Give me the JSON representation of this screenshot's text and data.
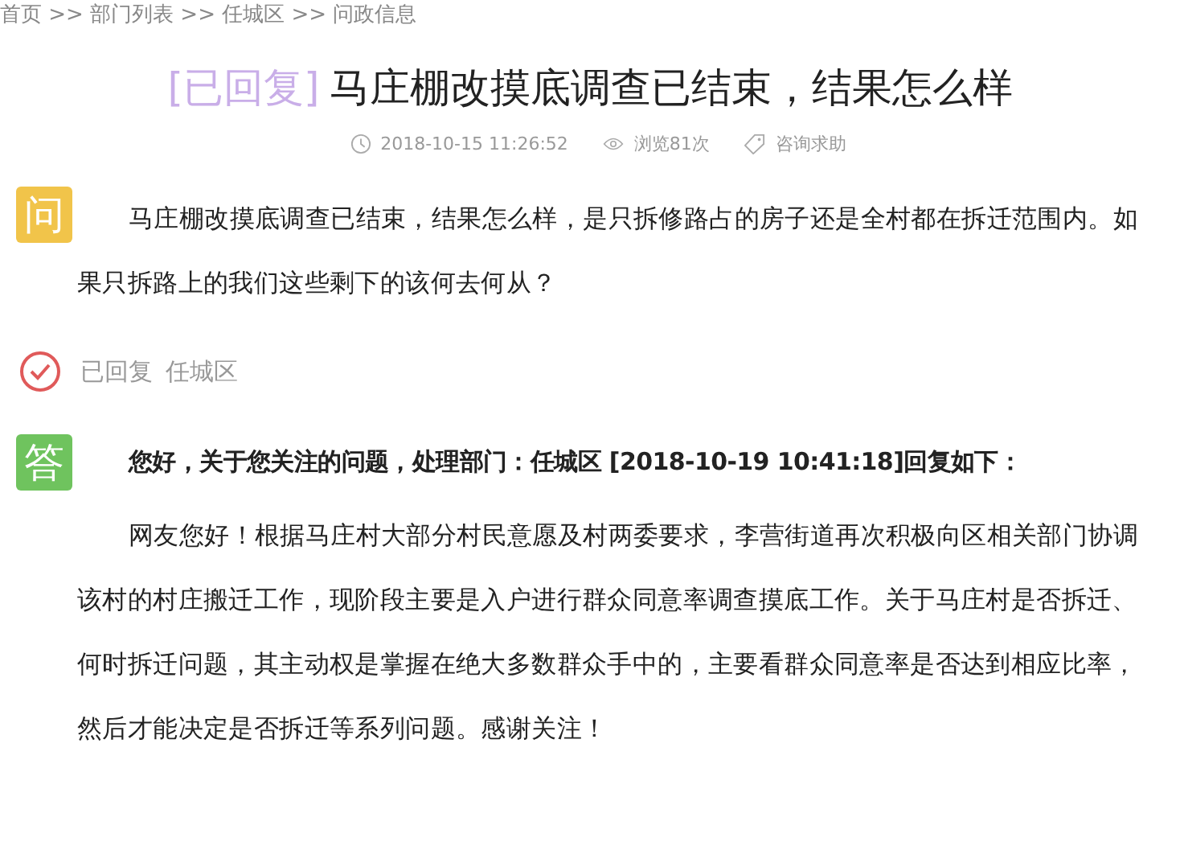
{
  "breadcrumb": "首页 >> 部门列表 >> 任城区 >> 问政信息",
  "title": {
    "status": "[已回复]",
    "text": "马庄棚改摸底调查已结束，结果怎么样"
  },
  "meta": {
    "time": "2018-10-15 11:26:52",
    "views": "浏览81次",
    "category": "咨询求助"
  },
  "question": {
    "badge": "问",
    "text": "马庄棚改摸底调查已结束，结果怎么样，是只拆修路占的房子还是全村都在拆迁范围内。如果只拆路上的我们这些剩下的该何去何从？"
  },
  "reply_status": {
    "label": "已回复",
    "department": "任城区"
  },
  "answer": {
    "badge": "答",
    "header": "您好，关于您关注的问题，处理部门：任城区 [2018-10-19 10:41:18]回复如下：",
    "text": "网友您好！根据马庄村大部分村民意愿及村两委要求，李营街道再次积极向区相关部门协调该村的村庄搬迁工作，现阶段主要是入户进行群众同意率调查摸底工作。关于马庄村是否拆迁、何时拆迁问题，其主动权是掌握在绝大多数群众手中的，主要看群众同意率是否达到相应比率，然后才能决定是否拆迁等系列问题。感谢关注！"
  }
}
